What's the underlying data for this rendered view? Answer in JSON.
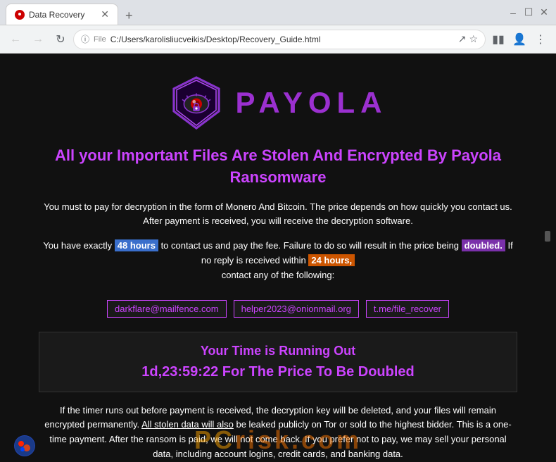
{
  "browser": {
    "title": "Data Recovery",
    "tab_label": "Data Recovery",
    "url_label": "File",
    "url_path": "C:/Users/karolisliucveikis/Desktop/Recovery_Guide.html",
    "new_tab_label": "+"
  },
  "page": {
    "logo_text": "PAYOLA",
    "main_heading": "All your Important Files Are Stolen And Encrypted By Payola Ransomware",
    "paragraph1": "You must to pay for decryption in the form of Monero And Bitcoin. The price depends on how quickly you contact us. After payment is received, you will receive the decryption software.",
    "paragraph2_before": "You have exactly",
    "highlight1": "48 hours",
    "paragraph2_middle": "to contact us and pay the fee. Failure to do so will result in the price being",
    "highlight2": "doubled.",
    "paragraph2_after": "If no reply is received within",
    "highlight3": "24 hours,",
    "paragraph2_end": "contact any of the following:",
    "contact1": "darkflare@mailfence.com",
    "contact2": "helper2023@onionmail.org",
    "contact3": "t.me/file_recover",
    "timer_heading": "Your Time is Running Out",
    "timer_value": "1d,23:59:22 For The Price To Be Doubled",
    "bottom_text": "If the timer runs out before payment is received, the decryption key will be deleted, and your files will remain encrypted permanently. All stolen data will also be leaked publicly on Tor or sold to the highest bidder. This is a one-time payment. After the ransom is paid, we will not come back. If you prefer not to pay, we may sell your personal data, including account logins, credit cards, and banking data.",
    "watermark": "risk.com"
  }
}
